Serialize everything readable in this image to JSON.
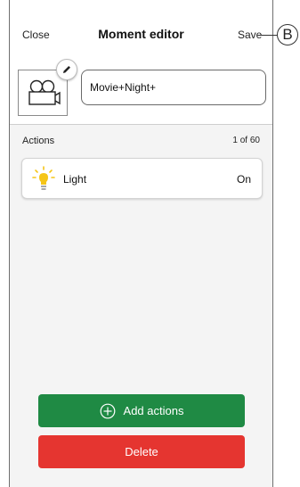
{
  "header": {
    "close_label": "Close",
    "title": "Moment editor",
    "save_label": "Save"
  },
  "moment": {
    "name_value": "Movie+Night+",
    "thumbnail_icon": "movie-camera-icon",
    "edit_icon": "pencil-icon"
  },
  "actions": {
    "section_title": "Actions",
    "count": "1 of 60",
    "items": [
      {
        "icon": "light-bulb-icon",
        "label": "Light",
        "value": "On"
      }
    ]
  },
  "buttons": {
    "add_label": "Add actions",
    "add_icon": "plus-circle-icon",
    "delete_label": "Delete"
  },
  "callout": {
    "label": "B"
  },
  "colors": {
    "add_button": "#1f8a44",
    "delete_button": "#e53530",
    "bulb_yellow": "#f5c518"
  }
}
